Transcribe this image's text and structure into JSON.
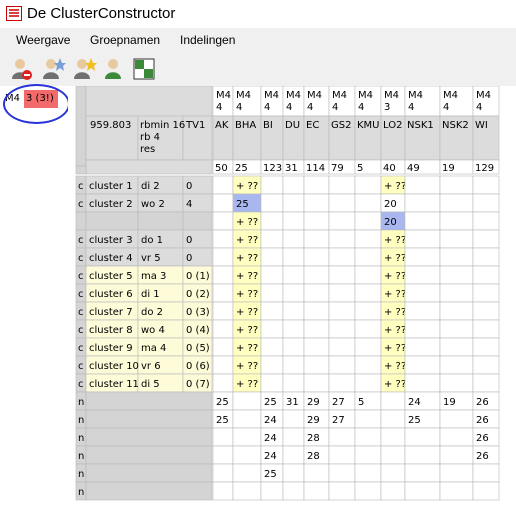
{
  "window": {
    "title": "De ClusterConstructor"
  },
  "menu": {
    "items": [
      "Weergave",
      "Groepnamen",
      "Indelingen"
    ]
  },
  "toolbar": {
    "icons": [
      "user-remove-icon",
      "user-star-icon",
      "user-add-star-icon",
      "user-icon",
      "grid-icon"
    ]
  },
  "left_panel": {
    "label": "M4",
    "badge": "3 (3!)",
    "badge_color": "#f26a6a"
  },
  "grid": {
    "info": [
      "959.803",
      "rbmin 16 rb 4 res",
      "TV1"
    ],
    "subject_groups": [
      "M4 4",
      "M4 4",
      "M4 4",
      "M4 4",
      "M4 4",
      "M4 4",
      "M4 4",
      "M4 3",
      "M4 4",
      "M4 4",
      "M4 4"
    ],
    "subjects": [
      "AK",
      "BHA",
      "BI",
      "DU",
      "EC",
      "GS2",
      "KMU",
      "LO2",
      "NSK1",
      "NSK2",
      "WI"
    ],
    "totals": [
      "50",
      "25",
      "123",
      "31",
      "114",
      "79",
      "5",
      "40",
      "49",
      "19",
      "129"
    ],
    "clusters": [
      {
        "type": "c",
        "name": "cluster 1",
        "slot": "di 2",
        "count": "0",
        "cells": {
          "1": "+ ??",
          "7": "+ ??"
        }
      },
      {
        "type": "c",
        "name": "cluster 2",
        "slot": "wo 2",
        "count": "4",
        "cells": {
          "1": "25",
          "7": "20"
        },
        "extra": [
          {
            "1": "+ ??",
            "7": "20"
          }
        ]
      },
      {
        "type": "c",
        "name": "cluster 3",
        "slot": "do 1",
        "count": "0",
        "cells": {
          "1": "+ ??",
          "7": "+ ??"
        }
      },
      {
        "type": "c",
        "name": "cluster 4",
        "slot": "vr 5",
        "count": "0",
        "cells": {
          "1": "+ ??",
          "7": "+ ??"
        }
      },
      {
        "type": "c",
        "name": "cluster 5",
        "slot": "ma 3",
        "count": "0 (1)",
        "cells": {
          "1": "+ ??",
          "7": "+ ??"
        }
      },
      {
        "type": "c",
        "name": "cluster 6",
        "slot": "di 1",
        "count": "0 (2)",
        "cells": {
          "1": "+ ??",
          "7": "+ ??"
        }
      },
      {
        "type": "c",
        "name": "cluster 7",
        "slot": "do 2",
        "count": "0 (3)",
        "cells": {
          "1": "+ ??",
          "7": "+ ??"
        }
      },
      {
        "type": "c",
        "name": "cluster 8",
        "slot": "wo 4",
        "count": "0 (4)",
        "cells": {
          "1": "+ ??",
          "7": "+ ??"
        }
      },
      {
        "type": "c",
        "name": "cluster 9",
        "slot": "ma 4",
        "count": "0 (5)",
        "cells": {
          "1": "+ ??",
          "7": "+ ??"
        }
      },
      {
        "type": "c",
        "name": "cluster 10",
        "slot": "vr 6",
        "count": "0 (6)",
        "cells": {
          "1": "+ ??",
          "7": "+ ??"
        }
      },
      {
        "type": "c",
        "name": "cluster 11",
        "slot": "di 5",
        "count": "0 (7)",
        "cells": {
          "1": "+ ??",
          "7": "+ ??"
        }
      }
    ],
    "n_rows": [
      {
        "type": "n",
        "cells": {
          "0": "25",
          "2": "25",
          "3": "31",
          "4": "29",
          "5": "27",
          "6": "5",
          "8": "24",
          "9": "19",
          "10": "26"
        }
      },
      {
        "type": "n",
        "cells": {
          "0": "25",
          "2": "24",
          "4": "29",
          "5": "27",
          "8": "25",
          "10": "26"
        }
      },
      {
        "type": "n",
        "cells": {
          "2": "24",
          "4": "28",
          "10": "26"
        }
      },
      {
        "type": "n",
        "cells": {
          "2": "24",
          "4": "28",
          "10": "26"
        }
      },
      {
        "type": "n",
        "cells": {
          "2": "25"
        }
      },
      {
        "type": "n",
        "cells": {}
      }
    ],
    "colors": {
      "yellow": "#ffffc0",
      "blue": "#a9b7f0",
      "lightyellow": "#fdfbd8",
      "header": "#dcdcdc",
      "gray": "#d4d4d4"
    }
  }
}
